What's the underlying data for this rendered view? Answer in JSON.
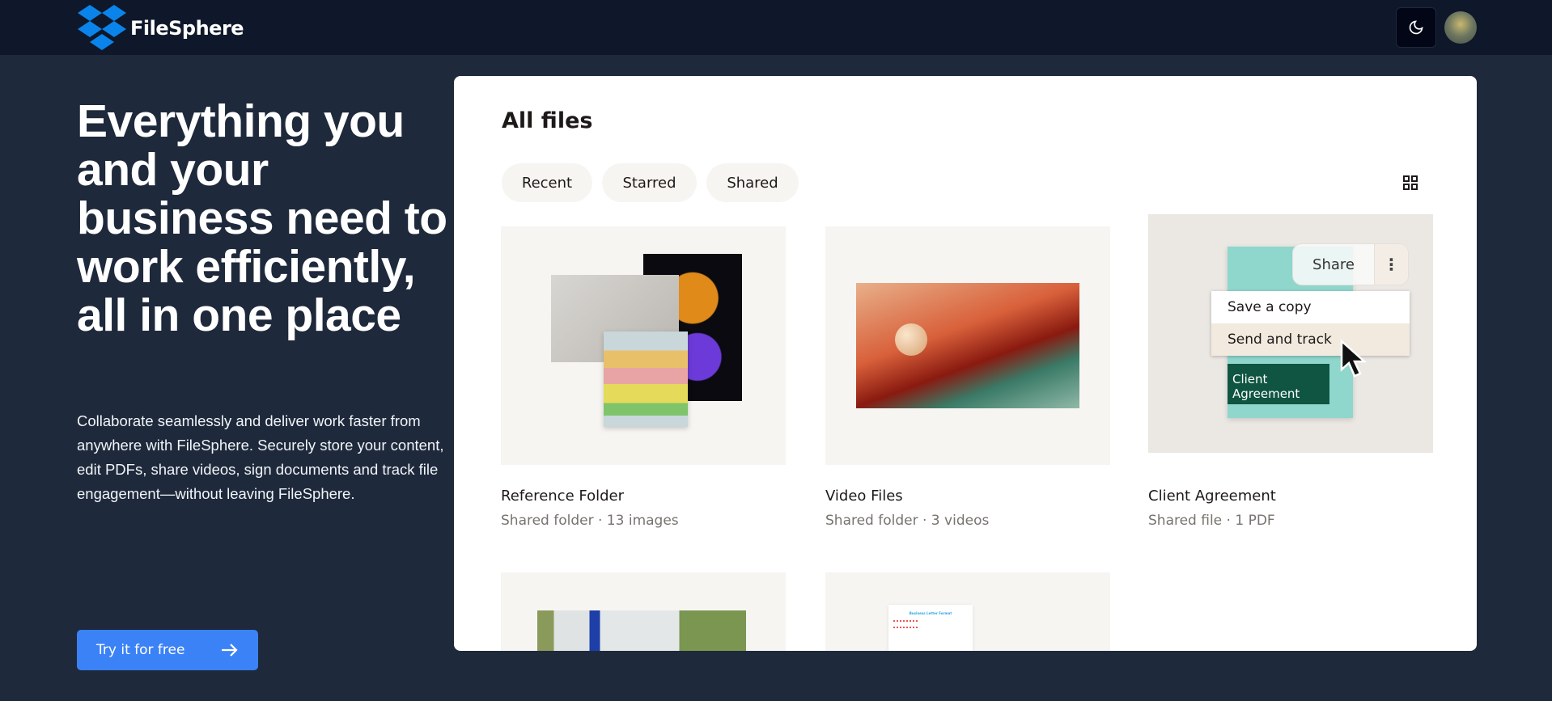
{
  "header": {
    "brand": "FileSphere",
    "theme_icon": "moon-icon",
    "avatar": "user-avatar"
  },
  "hero": {
    "title": "Everything you and your business need to work efficiently, all in one place",
    "description": "Collaborate seamlessly and deliver work faster from anywhere with FileSphere. Securely store your content, edit PDFs, share videos, sign documents and track file engagement—without leaving FileSphere.",
    "cta": "Try it for free"
  },
  "panel": {
    "title": "All files",
    "tabs": [
      "Recent",
      "Starred",
      "Shared"
    ],
    "cards": [
      {
        "name": "Reference Folder",
        "meta": "Shared folder · 13 images"
      },
      {
        "name": "Video Files",
        "meta": "Shared folder · 3 videos"
      },
      {
        "name": "Client Agreement",
        "meta": "Shared file · 1 PDF"
      }
    ],
    "share_label": "Share",
    "menu": [
      "Save a copy",
      "Send and track"
    ],
    "doc_label": "Client Agreement",
    "letter_title": "Business Letter Format"
  }
}
